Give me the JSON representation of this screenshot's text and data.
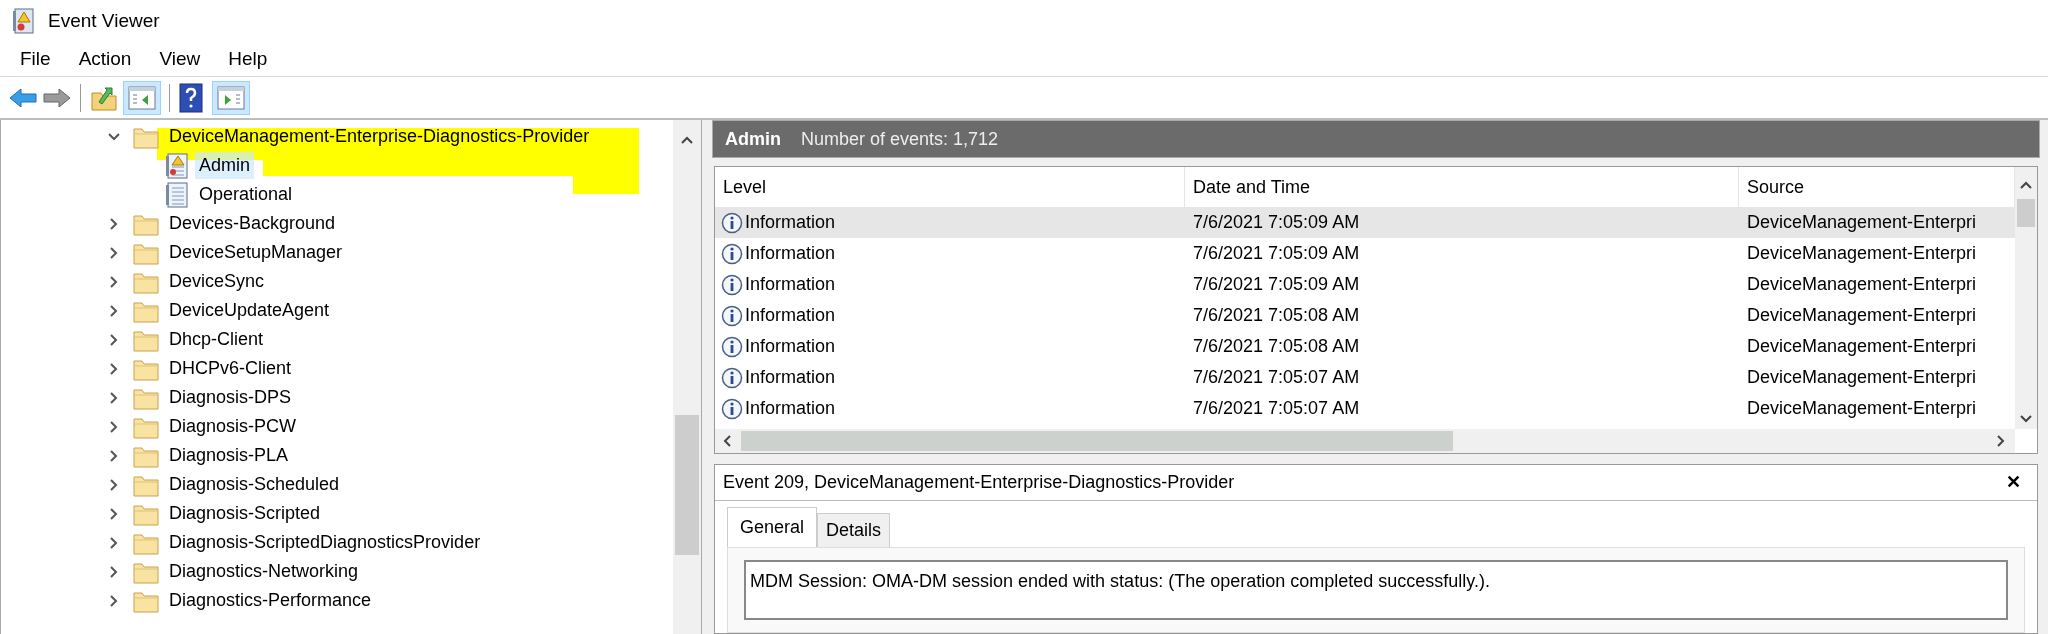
{
  "window": {
    "title": "Event Viewer"
  },
  "menu": [
    "File",
    "Action",
    "View",
    "Help"
  ],
  "tree": [
    {
      "label": "DeviceManagement-Enterprise-Diagnostics-Provider",
      "expanded": true,
      "highlighted": true,
      "children": [
        {
          "label": "Admin",
          "kind": "admin-log",
          "selected": true
        },
        {
          "label": "Operational",
          "kind": "log",
          "selected": false
        }
      ]
    },
    {
      "label": "Devices-Background",
      "expanded": false,
      "highlighted": false
    },
    {
      "label": "DeviceSetupManager",
      "expanded": false,
      "highlighted": false
    },
    {
      "label": "DeviceSync",
      "expanded": false,
      "highlighted": false
    },
    {
      "label": "DeviceUpdateAgent",
      "expanded": false,
      "highlighted": false
    },
    {
      "label": "Dhcp-Client",
      "expanded": false,
      "highlighted": false
    },
    {
      "label": "DHCPv6-Client",
      "expanded": false,
      "highlighted": false
    },
    {
      "label": "Diagnosis-DPS",
      "expanded": false,
      "highlighted": false
    },
    {
      "label": "Diagnosis-PCW",
      "expanded": false,
      "highlighted": false
    },
    {
      "label": "Diagnosis-PLA",
      "expanded": false,
      "highlighted": false
    },
    {
      "label": "Diagnosis-Scheduled",
      "expanded": false,
      "highlighted": false
    },
    {
      "label": "Diagnosis-Scripted",
      "expanded": false,
      "highlighted": false
    },
    {
      "label": "Diagnosis-ScriptedDiagnosticsProvider",
      "expanded": false,
      "highlighted": false
    },
    {
      "label": "Diagnostics-Networking",
      "expanded": false,
      "highlighted": false
    },
    {
      "label": "Diagnostics-Performance",
      "expanded": false,
      "highlighted": false
    }
  ],
  "log_header": {
    "name": "Admin",
    "count": "Number of events: 1,712"
  },
  "table": {
    "columns": [
      "Level",
      "Date and Time",
      "Source"
    ],
    "rows": [
      {
        "level": "Information",
        "date_time": "7/6/2021 7:05:09 AM",
        "source": "DeviceManagement-Enterpri",
        "selected": true
      },
      {
        "level": "Information",
        "date_time": "7/6/2021 7:05:09 AM",
        "source": "DeviceManagement-Enterpri",
        "selected": false
      },
      {
        "level": "Information",
        "date_time": "7/6/2021 7:05:09 AM",
        "source": "DeviceManagement-Enterpri",
        "selected": false
      },
      {
        "level": "Information",
        "date_time": "7/6/2021 7:05:08 AM",
        "source": "DeviceManagement-Enterpri",
        "selected": false
      },
      {
        "level": "Information",
        "date_time": "7/6/2021 7:05:08 AM",
        "source": "DeviceManagement-Enterpri",
        "selected": false
      },
      {
        "level": "Information",
        "date_time": "7/6/2021 7:05:07 AM",
        "source": "DeviceManagement-Enterpri",
        "selected": false
      },
      {
        "level": "Information",
        "date_time": "7/6/2021 7:05:07 AM",
        "source": "DeviceManagement-Enterpri",
        "selected": false
      }
    ]
  },
  "event_panel": {
    "title": "Event 209, DeviceManagement-Enterprise-Diagnostics-Provider",
    "close": "✕",
    "tabs": [
      {
        "label": "General",
        "selected": true
      },
      {
        "label": "Details",
        "selected": false
      }
    ],
    "message": "MDM Session: OMA-DM session ended with status: (The operation completed successfully.)."
  }
}
